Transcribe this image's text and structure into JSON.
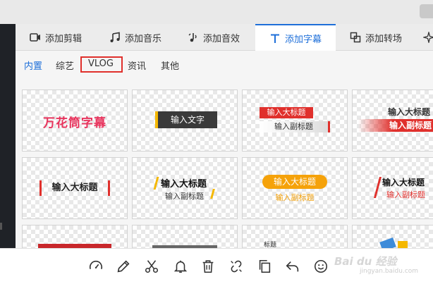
{
  "tabs": [
    {
      "label": "添加剪辑"
    },
    {
      "label": "添加音乐"
    },
    {
      "label": "添加音效"
    },
    {
      "label": "添加字幕"
    },
    {
      "label": "添加转场"
    }
  ],
  "subtabs": [
    "内置",
    "综艺",
    "VLOG",
    "资讯",
    "其他"
  ],
  "templates": {
    "card1_text": "万花筒字幕",
    "card2_text": "输入文字",
    "card3_title": "输入大标题",
    "card3_sub": "输入副标题",
    "card4_title": "输入大标题",
    "card4_sub": "输入副标题",
    "card5_text": "输入大标题",
    "card6_title": "输入大标题",
    "card6_sub": "输入副标题",
    "card7_title": "输入大标题",
    "card7_sub": "输入副标题",
    "card8_title": "输入大标题",
    "card8_sub": "输入副标题",
    "card11_text": "标题"
  },
  "watermark": {
    "main": "Bai du 经验",
    "sub": "jingyan.baidu.com"
  },
  "colors": {
    "accent": "#1e6fd9",
    "highlight_box": "#e0302c",
    "pink": "#e8335c",
    "orange": "#f5a20a"
  }
}
